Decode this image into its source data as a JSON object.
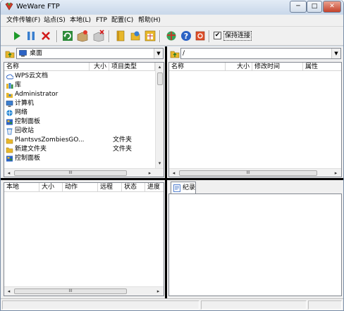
{
  "window": {
    "title": "WeWare FTP",
    "minimize_glyph": "─",
    "maximize_glyph": "□",
    "close_glyph": "✕"
  },
  "menu": [
    {
      "label": "文件传输(F)"
    },
    {
      "label": "站点(S)"
    },
    {
      "label": "本地(L)"
    },
    {
      "label": "FTP"
    },
    {
      "label": "配置(C)"
    },
    {
      "label": "帮助(H)"
    }
  ],
  "toolbar": {
    "icons": [
      "play-icon",
      "pause-icon",
      "stop-icon",
      "refresh-icon",
      "add-box-icon",
      "delete-box-icon",
      "book-icon",
      "folder-sync-icon",
      "grid-icon",
      "globe-icon",
      "help-icon",
      "exit-icon"
    ],
    "keep_connection": {
      "label": "保持连接",
      "checked": true,
      "check_glyph": "✔"
    }
  },
  "local": {
    "path": "桌面",
    "arrow_glyph": "▼",
    "columns": [
      "名称",
      "大小",
      "项目类型"
    ],
    "rows": [
      {
        "icon": "cloud-icon",
        "name": "WPS云文档",
        "type": ""
      },
      {
        "icon": "library-icon",
        "name": "库",
        "type": ""
      },
      {
        "icon": "user-folder-icon",
        "name": "Administrator",
        "type": ""
      },
      {
        "icon": "computer-icon",
        "name": "计算机",
        "type": ""
      },
      {
        "icon": "network-icon",
        "name": "网络",
        "type": ""
      },
      {
        "icon": "control-panel-icon",
        "name": "控制面板",
        "type": ""
      },
      {
        "icon": "recycle-bin-icon",
        "name": "回收站",
        "type": ""
      },
      {
        "icon": "folder-icon",
        "name": "PlantsvsZombiesGO...",
        "type": "文件夹"
      },
      {
        "icon": "folder-icon",
        "name": "新建文件夹",
        "type": "文件夹"
      },
      {
        "icon": "control-panel-icon",
        "name": "控制面板",
        "type": ""
      }
    ]
  },
  "remote": {
    "path": "/",
    "arrow_glyph": "▼",
    "columns": [
      "名称",
      "大小",
      "修改时间",
      "属性"
    ]
  },
  "queue": {
    "columns": [
      "本地",
      "大小",
      "动作",
      "远程",
      "状态",
      "进度"
    ]
  },
  "log": {
    "tab_label": "纪录"
  },
  "scroll": {
    "left": "◂",
    "right": "▸",
    "up": "▴",
    "down": "▾",
    "grip": "III"
  },
  "colors": {
    "window_frame": "#cfdceb",
    "splitter": "#000000",
    "close_button": "#c4422b",
    "play_green": "#1e9a2a",
    "stop_red": "#d21c1c"
  }
}
